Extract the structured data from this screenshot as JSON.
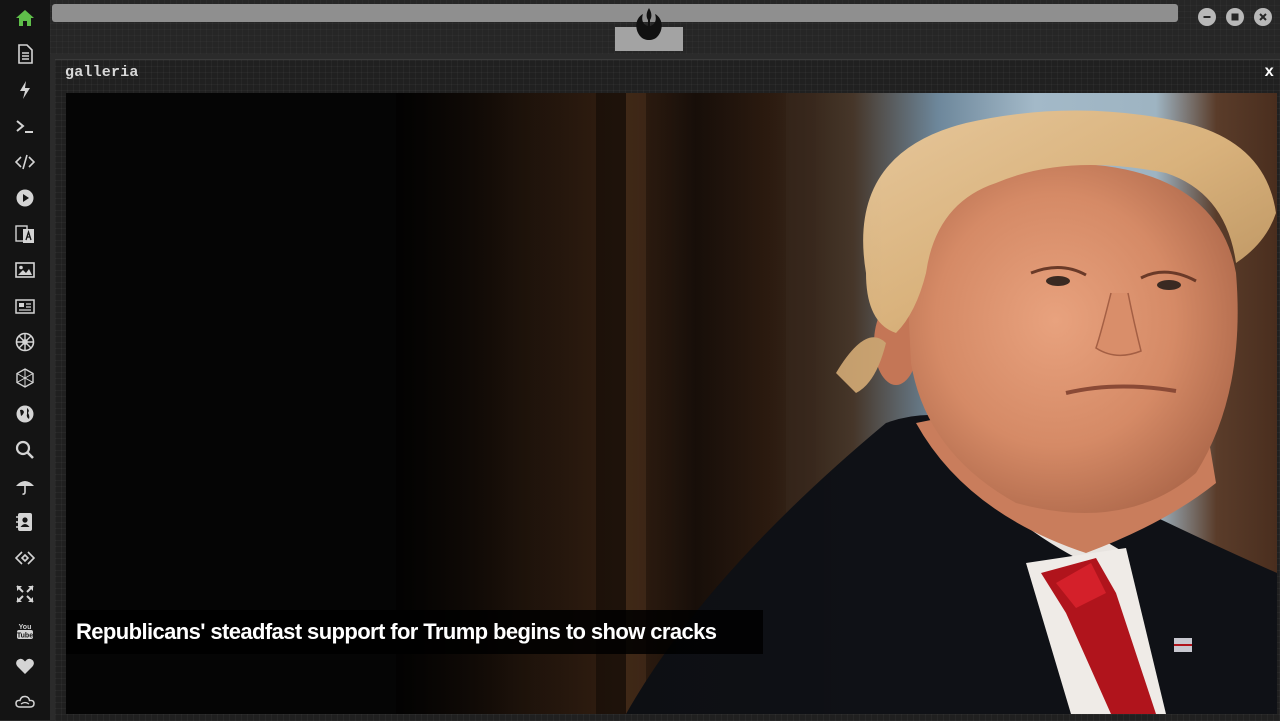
{
  "colors": {
    "sidebar_bg": "#141414",
    "icon_color": "#d4d4d4",
    "home_icon_color": "#5fbf4a",
    "panel_bg": "#202020",
    "caption_text": "#ffffff"
  },
  "sidebar": {
    "items": [
      {
        "icon": "home-icon",
        "active": true
      },
      {
        "icon": "document-icon"
      },
      {
        "icon": "lightning-icon"
      },
      {
        "icon": "terminal-icon"
      },
      {
        "icon": "code-icon"
      },
      {
        "icon": "play-icon"
      },
      {
        "icon": "translate-icon"
      },
      {
        "icon": "image-icon"
      },
      {
        "icon": "newspaper-icon"
      },
      {
        "icon": "empire-icon"
      },
      {
        "icon": "hexagon-network-icon"
      },
      {
        "icon": "globe-icon"
      },
      {
        "icon": "search-icon"
      },
      {
        "icon": "umbrella-icon"
      },
      {
        "icon": "contacts-icon"
      },
      {
        "icon": "code-diamond-icon"
      },
      {
        "icon": "expand-icon"
      },
      {
        "icon": "youtube-icon"
      },
      {
        "icon": "heart-icon"
      },
      {
        "icon": "cloud-link-icon"
      }
    ]
  },
  "window": {
    "controls": [
      "minimize-icon",
      "maximize-icon",
      "close-icon"
    ],
    "logo": "rebel-alliance-icon"
  },
  "panel": {
    "title": "galleria",
    "close_label": "x"
  },
  "gallery": {
    "caption": "Republicans' steadfast support for Trump begins to show cracks"
  }
}
